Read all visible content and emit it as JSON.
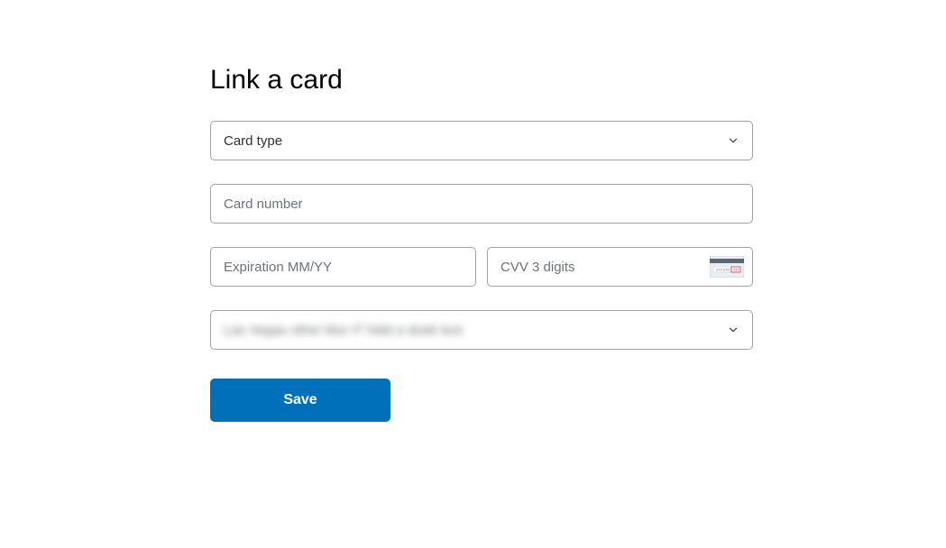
{
  "title": "Link a card",
  "cardType": {
    "label": "Card type"
  },
  "cardNumber": {
    "placeholder": "Card number",
    "value": ""
  },
  "expiration": {
    "placeholder": "Expiration MM/YY",
    "value": ""
  },
  "cvv": {
    "placeholder": "CVV 3 digits",
    "value": ""
  },
  "billingAddress": {
    "valueObscured": "Las Vegas other blur IT hidd a doek text"
  },
  "saveButton": {
    "label": "Save"
  }
}
